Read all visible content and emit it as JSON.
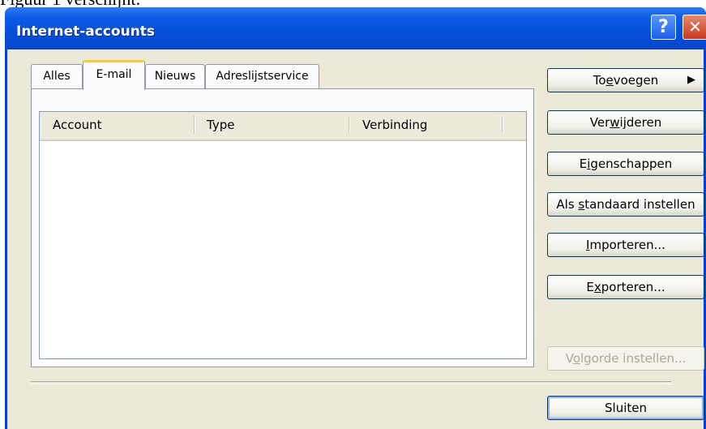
{
  "caption": "Figuur 1 verschijnt:",
  "window": {
    "title": "Internet-accounts",
    "help_glyph": "?",
    "close_glyph": "✕"
  },
  "tabs": [
    {
      "label": "Alles",
      "active": false
    },
    {
      "label": "E-mail",
      "active": true
    },
    {
      "label": "Nieuws",
      "active": false
    },
    {
      "label": "Adreslijstservice",
      "active": false
    }
  ],
  "list": {
    "columns": [
      "Account",
      "Type",
      "Verbinding"
    ],
    "rows": []
  },
  "buttons": {
    "add": {
      "pre": "To",
      "ul": "e",
      "post": "voegen",
      "arrow": "▶"
    },
    "remove": {
      "pre": "Ver",
      "ul": "w",
      "post": "ijderen"
    },
    "properties": {
      "pre": "E",
      "ul": "i",
      "post": "genschappen"
    },
    "set_default": {
      "pre": "Als ",
      "ul": "s",
      "post": "tandaard instellen"
    },
    "import": {
      "pre": "",
      "ul": "I",
      "post": "mporteren..."
    },
    "export": {
      "pre": "E",
      "ul": "x",
      "post": "porteren..."
    },
    "order": {
      "pre": "V",
      "ul": "o",
      "post": "lgorde instellen..."
    },
    "close": {
      "label": "Sluiten"
    }
  },
  "colors": {
    "titlebar": "#0550d8",
    "dialog_bg": "#ece9d8",
    "active_tab_accent": "#ffc83c"
  }
}
